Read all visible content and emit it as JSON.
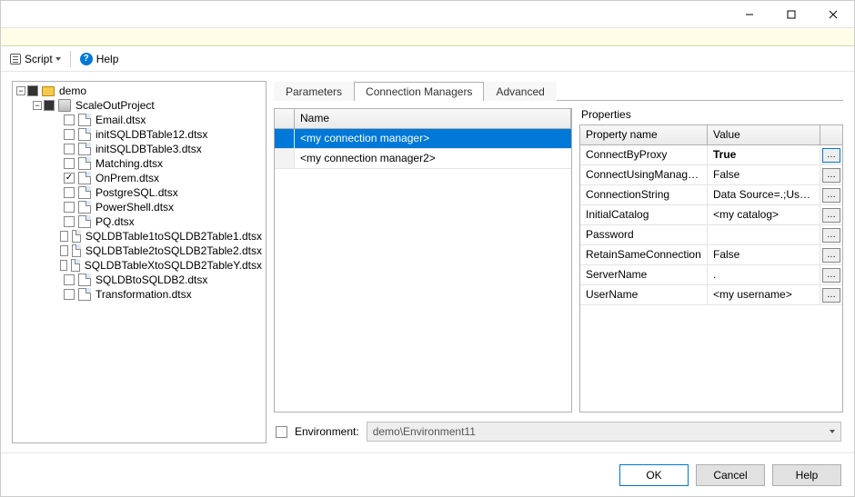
{
  "toolbar": {
    "script_label": "Script",
    "help_label": "Help"
  },
  "tree": {
    "root": "demo",
    "project": "ScaleOutProject",
    "packages": [
      "Email.dtsx",
      "initSQLDBTable12.dtsx",
      "initSQLDBTable3.dtsx",
      "Matching.dtsx",
      "OnPrem.dtsx",
      "PostgreSQL.dtsx",
      "PowerShell.dtsx",
      "PQ.dtsx",
      "SQLDBTable1toSQLDB2Table1.dtsx",
      "SQLDBTable2toSQLDB2Table2.dtsx",
      "SQLDBTableXtoSQLDB2TableY.dtsx",
      "SQLDBtoSQLDB2.dtsx",
      "Transformation.dtsx"
    ],
    "checked_index": 4
  },
  "tabs": [
    "Parameters",
    "Connection Managers",
    "Advanced"
  ],
  "active_tab": 1,
  "conn_grid": {
    "header": "Name",
    "rows": [
      "<my connection manager>",
      "<my connection manager2>"
    ],
    "selected_index": 0
  },
  "properties": {
    "title": "Properties",
    "headers": {
      "name": "Property name",
      "value": "Value"
    },
    "rows": [
      {
        "name": "ConnectByProxy",
        "value": "True",
        "bold": true,
        "btn_hl": true
      },
      {
        "name": "ConnectUsingManagedIdentity",
        "value": "False",
        "bold": false,
        "btn_hl": false
      },
      {
        "name": "ConnectionString",
        "value": "Data Source=.;User ID=...",
        "bold": false,
        "btn_hl": false
      },
      {
        "name": "InitialCatalog",
        "value": "<my catalog>",
        "bold": false,
        "btn_hl": false
      },
      {
        "name": "Password",
        "value": "",
        "bold": false,
        "btn_hl": false
      },
      {
        "name": "RetainSameConnection",
        "value": "False",
        "bold": false,
        "btn_hl": false
      },
      {
        "name": "ServerName",
        "value": ".",
        "bold": false,
        "btn_hl": false
      },
      {
        "name": "UserName",
        "value": "<my username>",
        "bold": false,
        "btn_hl": false
      }
    ]
  },
  "environment": {
    "label": "Environment:",
    "value": "demo\\Environment11"
  },
  "footer": {
    "ok": "OK",
    "cancel": "Cancel",
    "help": "Help"
  }
}
